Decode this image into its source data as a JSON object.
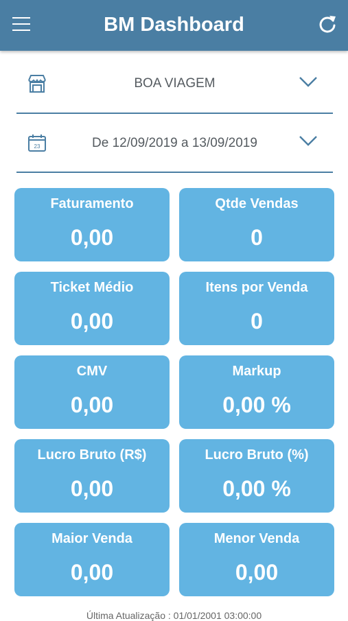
{
  "header": {
    "title": "BM Dashboard",
    "menu_icon": "hamburger-menu-icon",
    "refresh_icon": "refresh-icon",
    "color": "#4a7ea3"
  },
  "store_selector": {
    "icon": "store-icon",
    "value": "BOA VIAGEM"
  },
  "date_selector": {
    "icon": "calendar-icon",
    "calendar_day": "23",
    "value": "De 12/09/2019 a 13/09/2019"
  },
  "card_color": "#62b4e2",
  "cards": [
    {
      "label": "Faturamento",
      "value": "0,00"
    },
    {
      "label": "Qtde Vendas",
      "value": "0"
    },
    {
      "label": "Ticket Médio",
      "value": "0,00"
    },
    {
      "label": "Itens por Venda",
      "value": "0"
    },
    {
      "label": "CMV",
      "value": "0,00"
    },
    {
      "label": "Markup",
      "value": "0,00 %"
    },
    {
      "label": "Lucro Bruto (R$)",
      "value": "0,00"
    },
    {
      "label": "Lucro Bruto (%)",
      "value": "0,00 %"
    },
    {
      "label": "Maior Venda",
      "value": "0,00"
    },
    {
      "label": "Menor Venda",
      "value": "0,00"
    }
  ],
  "footer": {
    "text": "Última Atualização : 01/01/2001 03:00:00"
  }
}
